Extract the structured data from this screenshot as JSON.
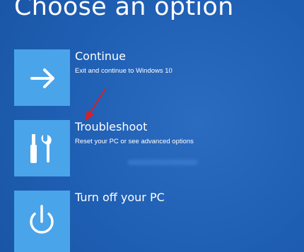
{
  "page": {
    "title": "Choose an option"
  },
  "options": [
    {
      "title": "Continue",
      "description": "Exit and continue to Windows 10",
      "icon": "arrow-right-icon"
    },
    {
      "title": "Troubleshoot",
      "description": "Reset your PC or see advanced options",
      "icon": "tools-icon"
    },
    {
      "title": "Turn off your PC",
      "description": "",
      "icon": "power-icon"
    }
  ],
  "colors": {
    "background": "#1f5fb4",
    "tile": "#4aa4ea",
    "text": "#ffffff",
    "annotation_arrow": "#d4202a"
  }
}
